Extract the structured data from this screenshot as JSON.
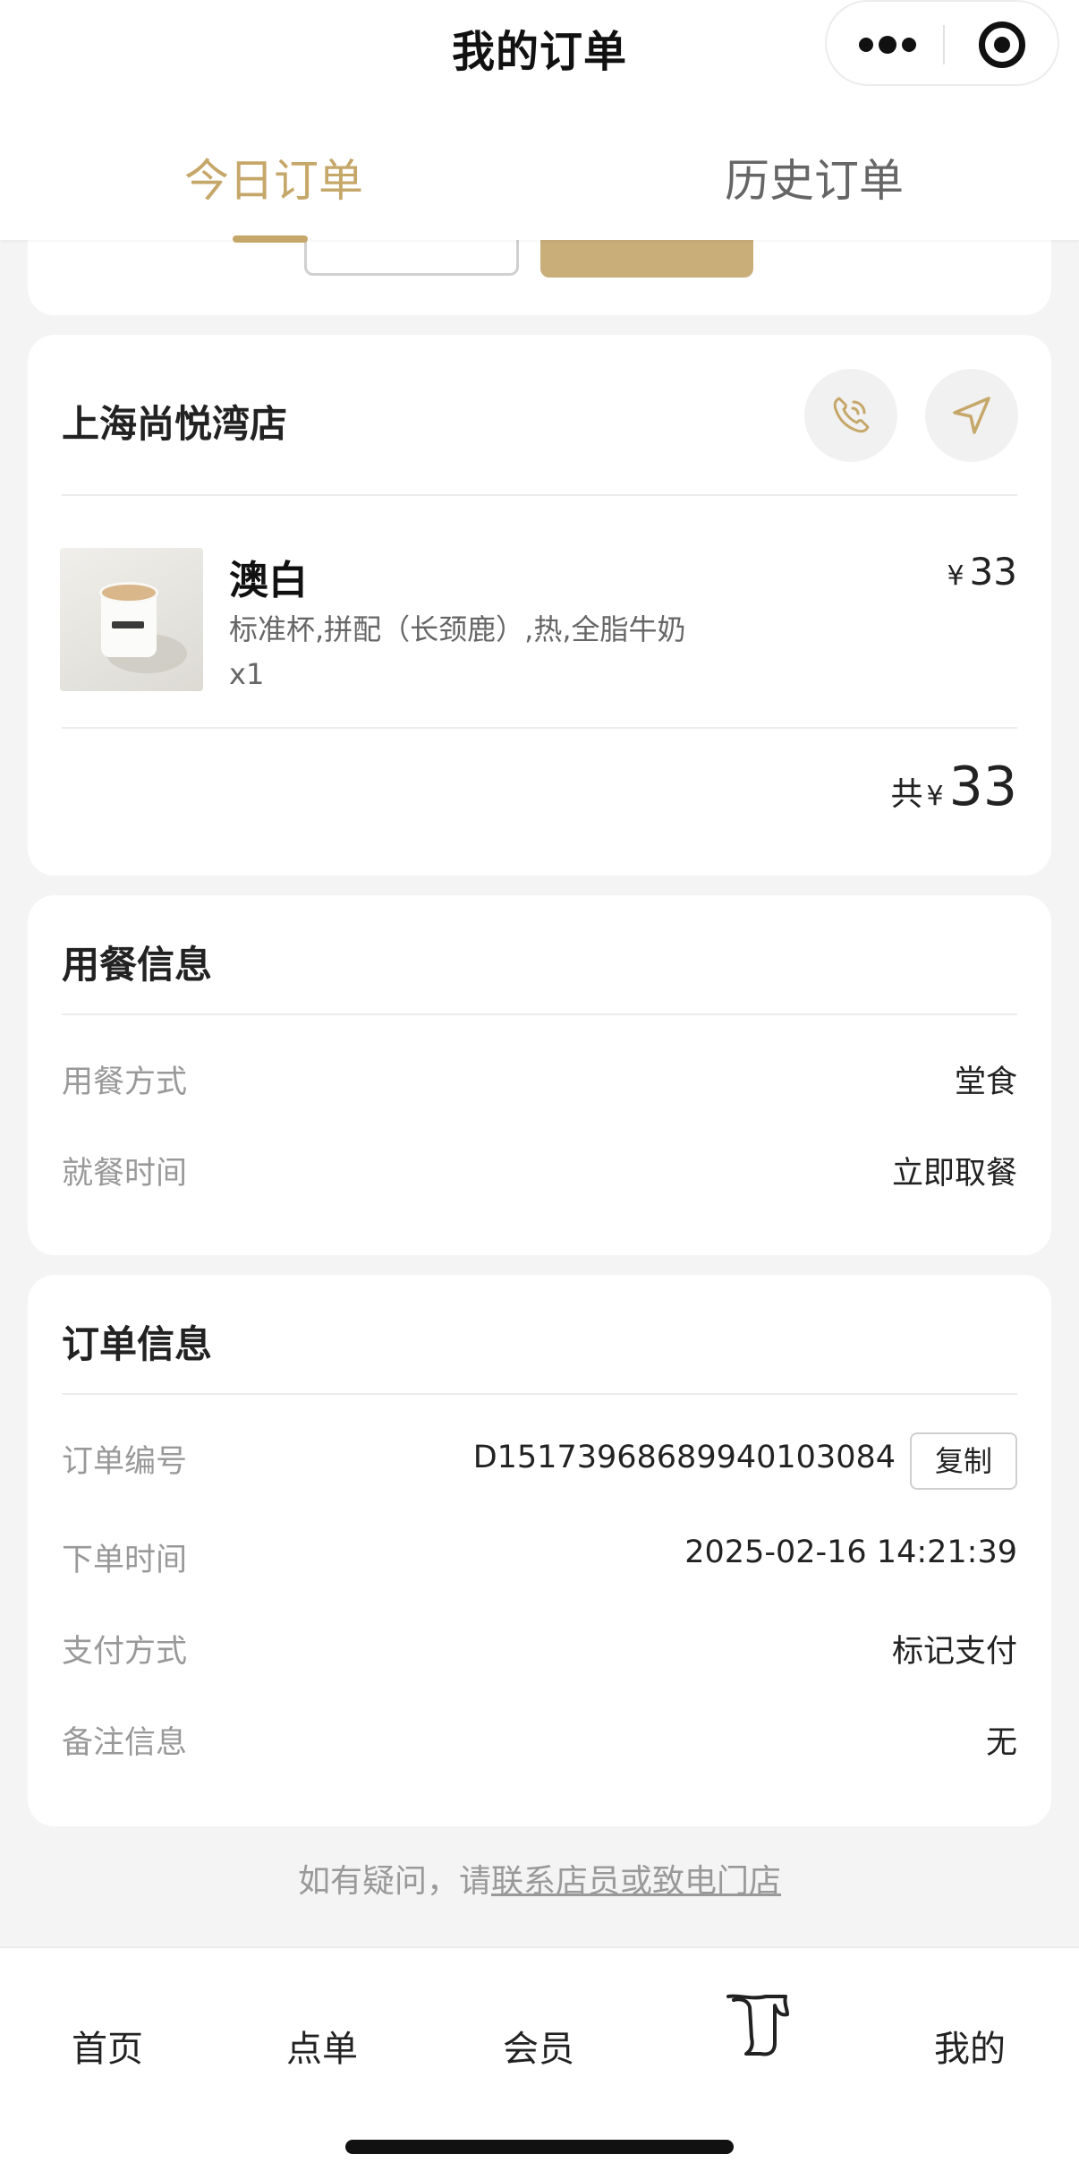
{
  "header": {
    "title": "我的订单"
  },
  "tabs": {
    "today": "今日订单",
    "history": "历史订单"
  },
  "colors": {
    "accent": "#c6a76a",
    "background": "#f4f4f4"
  },
  "store": {
    "name": "上海尚悦湾店",
    "phone_icon": "phone-icon",
    "navigate_icon": "navigate-icon"
  },
  "product": {
    "name": "澳白",
    "spec": "标准杯,拼配（长颈鹿）,热,全脂牛奶",
    "qty": "x1",
    "currency": "¥",
    "price": "33"
  },
  "total": {
    "label": "共",
    "currency": "¥",
    "amount": "33"
  },
  "dining": {
    "title": "用餐信息",
    "rows": [
      {
        "label": "用餐方式",
        "value": "堂食"
      },
      {
        "label": "就餐时间",
        "value": "立即取餐"
      }
    ]
  },
  "order": {
    "title": "订单信息",
    "rows": [
      {
        "label": "订单编号",
        "value": "D15173968689940103084"
      },
      {
        "label": "下单时间",
        "value": "2025-02-16 14:21:39"
      },
      {
        "label": "支付方式",
        "value": "标记支付"
      },
      {
        "label": "备注信息",
        "value": "无"
      }
    ],
    "copy_label": "复制"
  },
  "help": {
    "prefix": "如有疑问，请",
    "link": "联系店员或致电门店"
  },
  "tabbar": {
    "items": [
      "首页",
      "点单",
      "会员",
      "我的"
    ],
    "orders_icon": "receipt-scroll-icon"
  }
}
